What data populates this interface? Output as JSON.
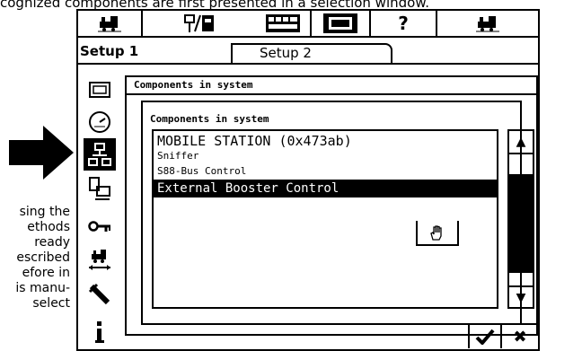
{
  "manual": {
    "top_text": "cognized components are first presented in a selection window.",
    "side_lines": [
      "sing the",
      "ethods",
      "ready",
      "escribed",
      "efore in",
      "is manu-",
      "select"
    ]
  },
  "toolbar": {
    "items": [
      "locomotive-icon",
      "signal-switch-icon",
      "keyboard-icon",
      "screen-icon",
      "help",
      "locomotive-icon"
    ],
    "help_label": "?"
  },
  "tabs": [
    {
      "label": "Setup 1",
      "active": true
    },
    {
      "label": "Setup 2",
      "active": false
    }
  ],
  "side_icons": [
    "display-icon",
    "gauge-icon",
    "network-icon",
    "computer-icon",
    "key-icon",
    "track-loco-icon",
    "tool-icon",
    "info-icon"
  ],
  "dialog": {
    "title": "Components in system",
    "inner_title": "Components in system",
    "components": [
      {
        "label": "MOBILE STATION (0x473ab)",
        "size": "large",
        "selected": false
      },
      {
        "label": "Sniffer",
        "size": "small",
        "selected": false
      },
      {
        "label": "S88-Bus Control",
        "size": "small",
        "selected": false
      },
      {
        "label": "External Booster Control",
        "size": "large",
        "selected": true
      }
    ],
    "scroll_up": "▲",
    "scroll_down": "▼"
  },
  "buttons": {
    "ok": "✔",
    "close": "✖"
  }
}
